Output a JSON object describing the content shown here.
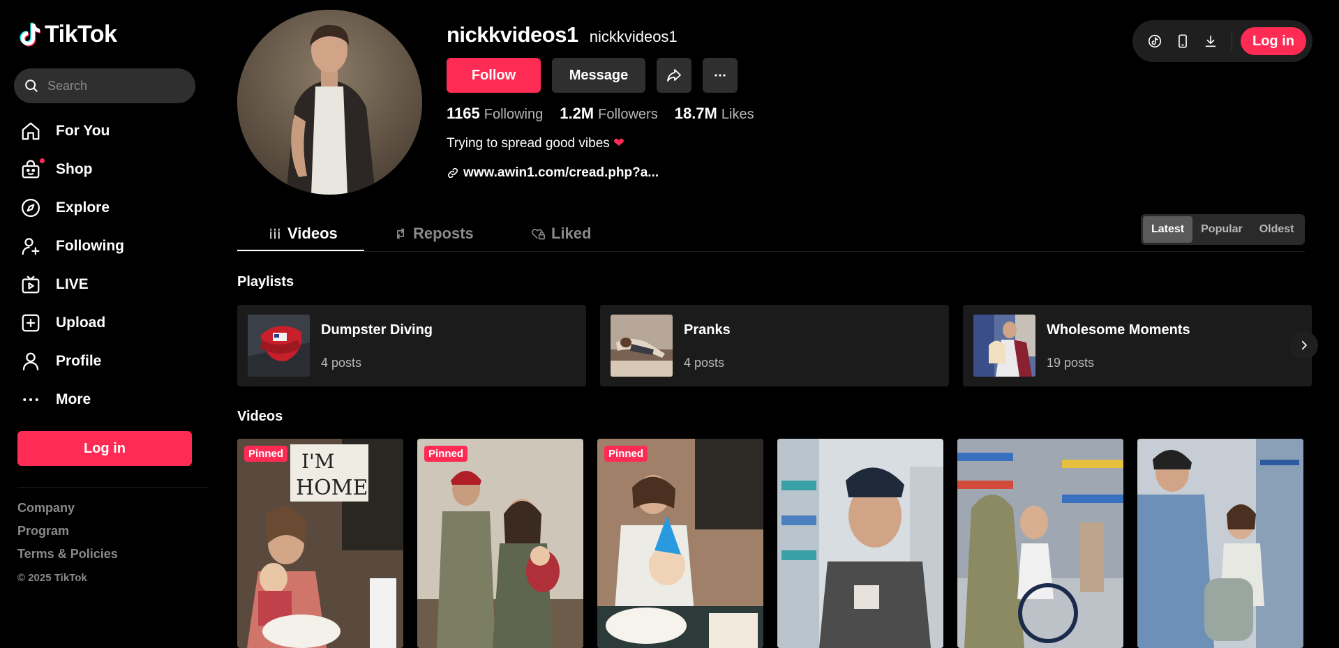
{
  "brand": {
    "name": "TikTok"
  },
  "search": {
    "placeholder": "Search"
  },
  "nav": [
    {
      "label": "For You",
      "icon": "home-icon"
    },
    {
      "label": "Shop",
      "icon": "shop-icon"
    },
    {
      "label": "Explore",
      "icon": "compass-icon"
    },
    {
      "label": "Following",
      "icon": "following-icon"
    },
    {
      "label": "LIVE",
      "icon": "live-icon"
    },
    {
      "label": "Upload",
      "icon": "upload-icon"
    },
    {
      "label": "Profile",
      "icon": "profile-icon"
    },
    {
      "label": "More",
      "icon": "more-icon"
    }
  ],
  "sidebar": {
    "login_label": "Log in",
    "footer": [
      "Company",
      "Program",
      "Terms & Policies"
    ],
    "copyright": "© 2025 TikTok"
  },
  "topbar": {
    "login_label": "Log in",
    "icons": [
      "tiktok-studio-icon",
      "mobile-icon",
      "download-icon"
    ]
  },
  "profile": {
    "username": "nickkvideos1",
    "nickname": "nickkvideos1",
    "follow_label": "Follow",
    "message_label": "Message",
    "stats": [
      {
        "value": "1165",
        "label": "Following"
      },
      {
        "value": "1.2M",
        "label": "Followers"
      },
      {
        "value": "18.7M",
        "label": "Likes"
      }
    ],
    "bio": "Trying to spread good vibes",
    "bio_emoji": "❤",
    "link": "www.awin1.com/cread.php?a..."
  },
  "tabs": [
    {
      "label": "Videos",
      "active": true
    },
    {
      "label": "Reposts",
      "active": false
    },
    {
      "label": "Liked",
      "active": false
    }
  ],
  "sort": {
    "options": [
      "Latest",
      "Popular",
      "Oldest"
    ],
    "selected": "Latest"
  },
  "playlists": {
    "title": "Playlists",
    "items": [
      {
        "name": "Dumpster Diving",
        "count": "4 posts"
      },
      {
        "name": "Pranks",
        "count": "4 posts"
      },
      {
        "name": "Wholesome Moments",
        "count": "19 posts"
      }
    ]
  },
  "videos": {
    "title": "Videos",
    "items": [
      {
        "badge": "Pinned"
      },
      {
        "badge": "Pinned"
      },
      {
        "badge": "Pinned"
      },
      {
        "badge": ""
      },
      {
        "badge": ""
      },
      {
        "badge": ""
      }
    ]
  },
  "colors": {
    "accent": "#fe2c55",
    "background": "#000000",
    "surface": "#1b1b1b"
  }
}
